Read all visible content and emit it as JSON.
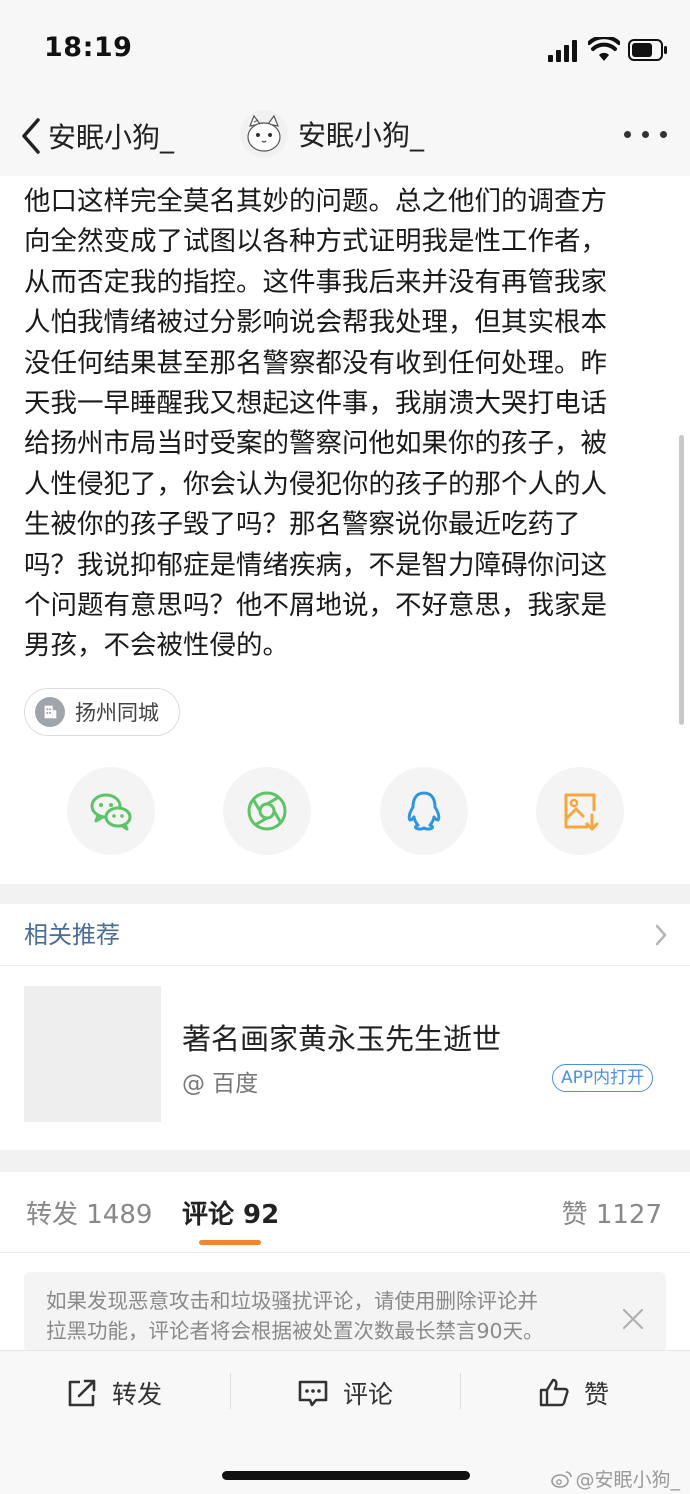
{
  "status": {
    "time": "18:19"
  },
  "nav": {
    "back_label": "安眠小狗_",
    "title": "安眠小狗_"
  },
  "article": {
    "text": "他口这样完全莫名其妙的问题。总之他们的调查方\n向全然变成了试图以各种方式证明我是性工作者，\n从而否定我的指控。这件事我后来并没有再管我家\n人怕我情绪被过分影响说会帮我处理，但其实根本\n没任何结果甚至那名警察都没有收到任何处理。昨\n天我一早睡醒我又想起这件事，我崩溃大哭打电话\n给扬州市局当时受案的警察问他如果你的孩子，被\n人性侵犯了，你会认为侵犯你的孩子的那个人的人\n生被你的孩子毁了吗？那名警察说你最近吃药了\n吗？我说抑郁症是情绪疾病，不是智力障碍你问这\n个问题有意思吗？他不屑地说，不好意思，我家是\n男孩，不会被性侵的。",
    "location_tag": "扬州同城"
  },
  "share": {
    "icons": [
      "wechat-icon",
      "moments-icon",
      "qq-icon",
      "save-image-icon"
    ],
    "colors": {
      "wechat": "#5ec267",
      "moments": "#5ec267",
      "qq": "#2e95de",
      "save": "#f6a63b"
    }
  },
  "related": {
    "section_title": "相关推荐",
    "item": {
      "headline": "著名画家黄永玉先生逝世",
      "source": "@ 百度",
      "app_button": "APP内打开"
    }
  },
  "tabs": {
    "repost": "转发 1489",
    "comments": "评论 92",
    "likes": "赞 1127",
    "active_color": "#f08733"
  },
  "notice": {
    "text": "如果发现恶意攻击和垃圾骚扰评论，请使用删除评论并\n拉黑功能，评论者将会根据被处置次数最长禁言90天。"
  },
  "bottom_bar": {
    "repost_label": "转发",
    "comment_label": "评论",
    "like_label": "赞"
  },
  "watermark": "@安眠小狗_"
}
